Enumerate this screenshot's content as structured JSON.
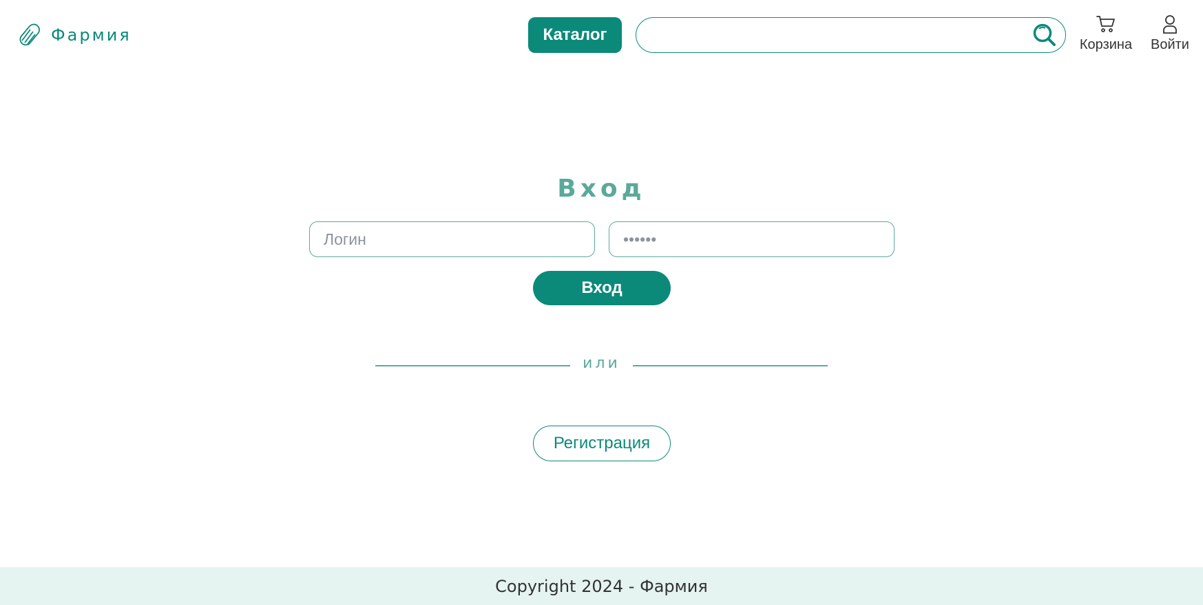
{
  "header": {
    "logo_text": "Фармия",
    "catalog_label": "Каталог",
    "search": {
      "value": "",
      "placeholder": ""
    },
    "cart_label": "Корзина",
    "login_label": "Войти"
  },
  "login_form": {
    "title": "Вход",
    "login_placeholder": "Логин",
    "password_placeholder": "••••••",
    "submit_label": "Вход",
    "divider_text": "или",
    "register_label": "Регистрация"
  },
  "footer": {
    "copyright": "Copyright 2024 - Фармия"
  },
  "colors": {
    "primary": "#0b8a7a",
    "accent_light": "#5aa99a",
    "footer_bg": "#e5f3f1"
  },
  "icons": {
    "logo": "pill-icon",
    "search": "search-icon",
    "cart": "cart-icon",
    "user": "user-icon"
  }
}
